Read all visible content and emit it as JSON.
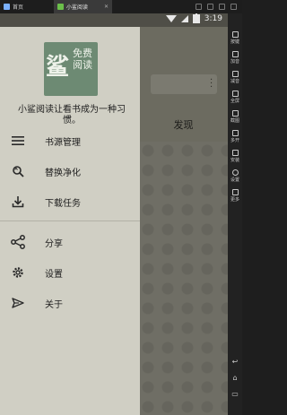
{
  "tabs": [
    {
      "label": "首页"
    },
    {
      "label": "小鲨阅读"
    }
  ],
  "status": {
    "time": "3:19"
  },
  "drawer": {
    "logo": {
      "big": "鲨",
      "small": "免费阅读"
    },
    "tagline": "小鲨阅读让看书成为一种习惯。",
    "items": [
      {
        "label": "书源管理",
        "icon": "list-icon"
      },
      {
        "label": "替换净化",
        "icon": "find-replace-icon"
      },
      {
        "label": "下载任务",
        "icon": "download-icon"
      },
      {
        "label": "分享",
        "icon": "share-icon"
      },
      {
        "label": "设置",
        "icon": "gear-icon"
      },
      {
        "label": "关于",
        "icon": "send-icon"
      }
    ]
  },
  "background_app": {
    "tab_label": "发现"
  },
  "emulator_toolbar": {
    "items": [
      {
        "label": "按键"
      },
      {
        "label": "加音"
      },
      {
        "label": "减音"
      },
      {
        "label": "全屏"
      },
      {
        "label": "截图"
      },
      {
        "label": "多开"
      },
      {
        "label": "安装"
      },
      {
        "label": "设置"
      },
      {
        "label": "更多"
      }
    ]
  },
  "colors": {
    "drawer_bg": "#d0cfc4",
    "scrim": "#6c6b60",
    "logo_green": "#6d8a73",
    "text": "#1e1e1e"
  }
}
